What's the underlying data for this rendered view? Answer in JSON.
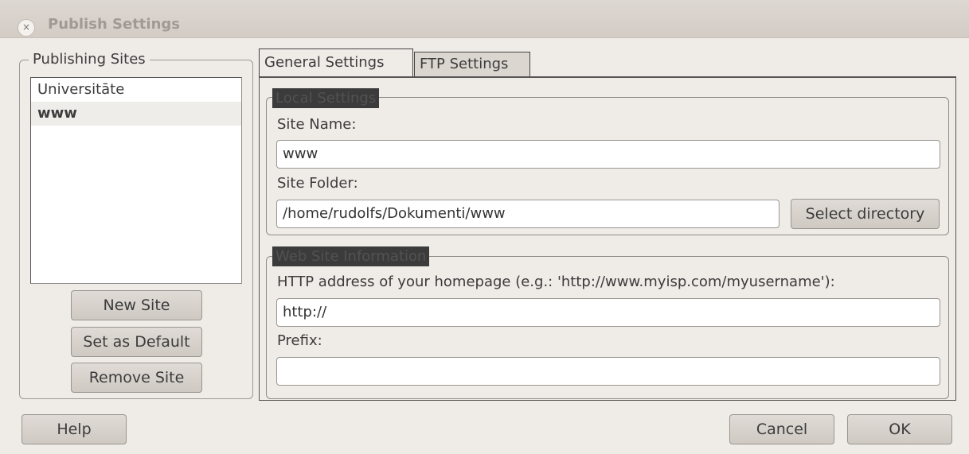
{
  "window": {
    "title": "Publish Settings",
    "close_glyph": "×"
  },
  "sites_group": {
    "legend": "Publishing Sites",
    "items": [
      {
        "label": "Universitāte",
        "selected": false
      },
      {
        "label": "www",
        "selected": true
      }
    ],
    "buttons": {
      "new_site": "New Site",
      "set_default": "Set as Default",
      "remove_site": "Remove Site"
    }
  },
  "tabs": [
    {
      "label": "General Settings",
      "active": true
    },
    {
      "label": "FTP Settings",
      "active": false
    }
  ],
  "local_settings": {
    "legend": "Local Settings",
    "site_name_label": "Site Name:",
    "site_name_value": "www",
    "site_folder_label": "Site Folder:",
    "site_folder_value": "/home/rudolfs/Dokumenti/www",
    "select_directory": "Select directory"
  },
  "web_site_info": {
    "legend": "Web Site Information",
    "http_label": "HTTP address of your homepage (e.g.: 'http://www.myisp.com/myusername'):",
    "http_value": "http://",
    "prefix_label": "Prefix:",
    "prefix_value": ""
  },
  "footer": {
    "help": "Help",
    "cancel": "Cancel",
    "ok": "OK"
  }
}
